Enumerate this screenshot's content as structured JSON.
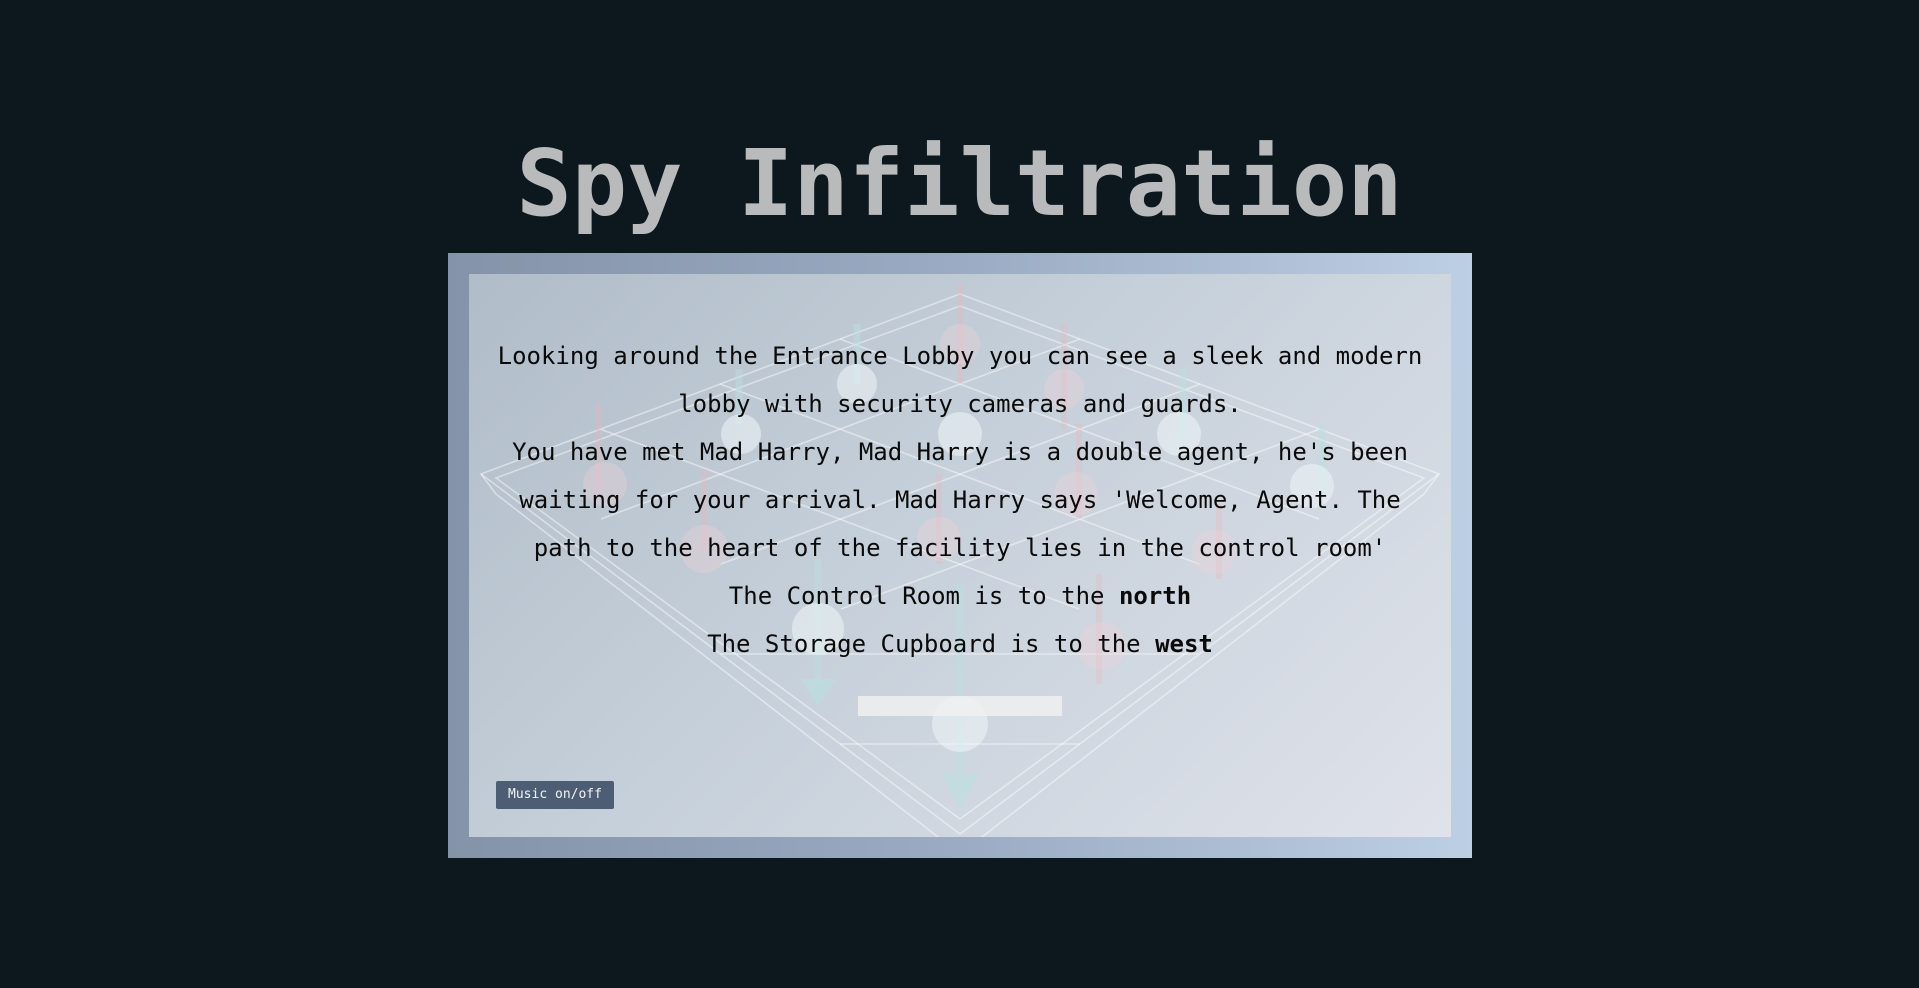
{
  "game": {
    "title": "Spy Infiltration"
  },
  "scene": {
    "description": "Looking around the Entrance Lobby you can see a sleek and modern lobby with security cameras and guards.",
    "encounter": "You have met Mad Harry, Mad Harry is a double agent, he's been waiting for your arrival. Mad Harry says 'Welcome, Agent. The path to the heart of the facility lies in the control room'",
    "exits": [
      {
        "prefix": "The Control Room is to the ",
        "direction": "north"
      },
      {
        "prefix": "The Storage Cupboard is to the ",
        "direction": "west"
      }
    ]
  },
  "command_input": {
    "value": "",
    "placeholder": ""
  },
  "controls": {
    "music_label": "Music on/off"
  },
  "colors": {
    "page_background": "#0c181e",
    "title": "#b9babb",
    "button": "#4d5e74",
    "text": "#0a0a0a"
  }
}
